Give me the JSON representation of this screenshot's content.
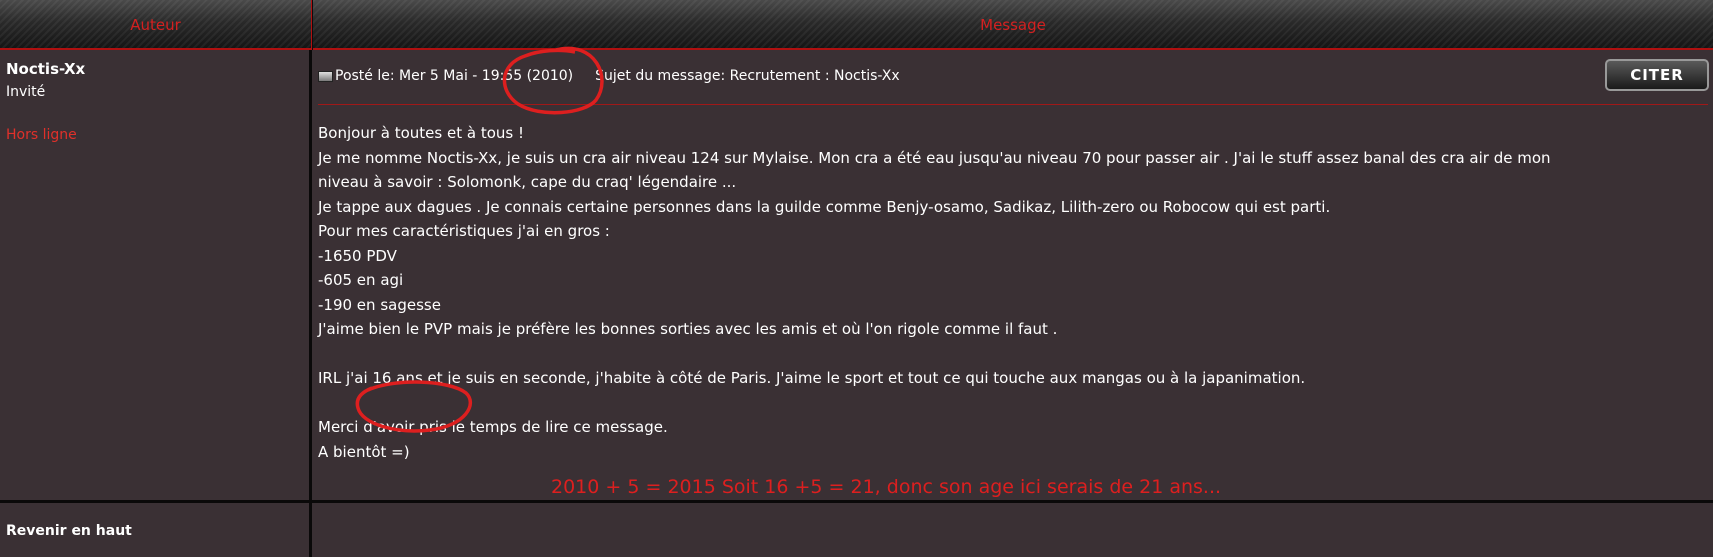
{
  "table": {
    "header_author": "Auteur",
    "header_message": "Message"
  },
  "author": {
    "name": "Noctis-Xx",
    "rank": "Invité",
    "status": "Hors ligne"
  },
  "post": {
    "posted_label": "Posté le: Mer 5 Mai - 19:55 (2010)",
    "subject_label": "Sujet du message: Recrutement : Noctis-Xx",
    "quote_button": "CITER",
    "lines": [
      "Bonjour à toutes et à tous !",
      "Je me nomme Noctis-Xx, je suis un cra air niveau 124 sur Mylaise. Mon cra a été eau jusqu'au niveau 70 pour passer air . J'ai le stuff assez banal des cra air de mon",
      "niveau à savoir : Solomonk, cape du craq' légendaire ...",
      "Je tappe aux dagues . Je connais certaine personnes dans la guilde comme Benjy-osamo, Sadikaz, Lilith-zero ou Robocow qui est parti.",
      "Pour mes caractéristiques j'ai en gros :",
      "-1650 PDV",
      "-605 en agi",
      "-190 en sagesse",
      "J'aime bien le PVP mais je préfère les bonnes sorties avec les amis et où l'on rigole comme il faut .",
      "",
      "IRL j'ai 16 ans et je suis en seconde, j'habite à côté de Paris. J'aime le sport et tout ce qui touche aux mangas ou à la japanimation.",
      "",
      "Merci d'avoir pris le temps de lire ce message.",
      "A bientôt =)"
    ]
  },
  "annotation": {
    "text": "2010 + 5 = 2015 Soit 16 +5 = 21, donc son age ici serais de 21 ans...",
    "color": "#dd1f1f"
  },
  "footer": {
    "back_to_top": "Revenir en haut"
  },
  "colors": {
    "accent_red": "#d42020",
    "cell_bg": "#3a3034"
  }
}
